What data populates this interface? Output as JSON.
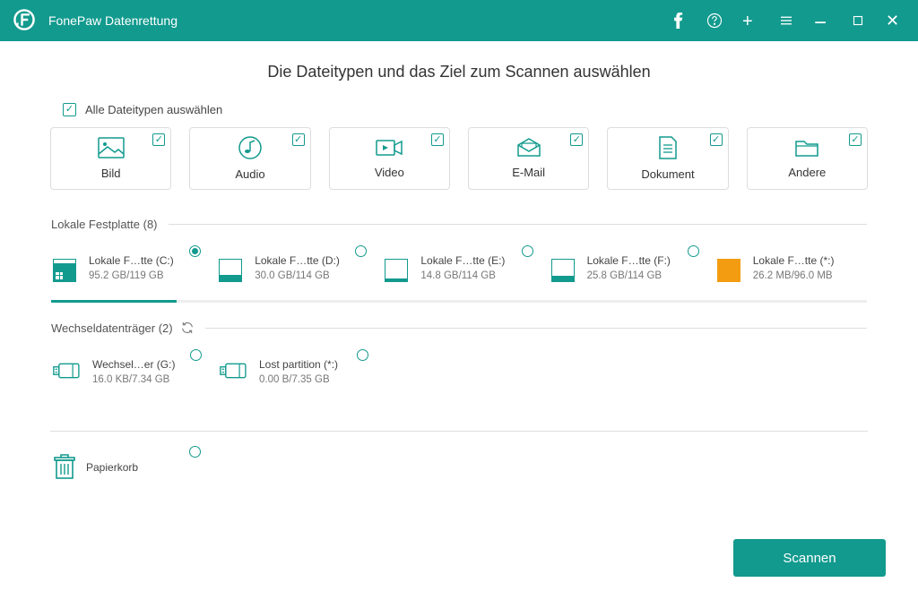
{
  "app": {
    "title": "FonePaw Datenrettung"
  },
  "heading": "Die Dateitypen und das Ziel zum Scannen auswählen",
  "selectAll": {
    "label": "Alle Dateitypen auswählen"
  },
  "types": {
    "image": "Bild",
    "audio": "Audio",
    "video": "Video",
    "email": "E-Mail",
    "document": "Dokument",
    "other": "Andere"
  },
  "sections": {
    "local": {
      "title": "Lokale Festplatte (8)"
    },
    "removable": {
      "title": "Wechseldatenträger (2)"
    }
  },
  "localDisks": [
    {
      "name": "Lokale F…tte (C:)",
      "size": "95.2 GB/119 GB"
    },
    {
      "name": "Lokale F…tte (D:)",
      "size": "30.0 GB/114 GB"
    },
    {
      "name": "Lokale F…tte (E:)",
      "size": "14.8 GB/114 GB"
    },
    {
      "name": "Lokale F…tte (F:)",
      "size": "25.8 GB/114 GB"
    },
    {
      "name": "Lokale F…tte (*:)",
      "size": "26.2 MB/96.0 MB"
    }
  ],
  "removableDisks": [
    {
      "name": "Wechsel…er (G:)",
      "size": "16.0 KB/7.34 GB"
    },
    {
      "name": "Lost partition (*:)",
      "size": "0.00  B/7.35 GB"
    }
  ],
  "trash": {
    "label": "Papierkorb"
  },
  "scan": {
    "label": "Scannen"
  }
}
